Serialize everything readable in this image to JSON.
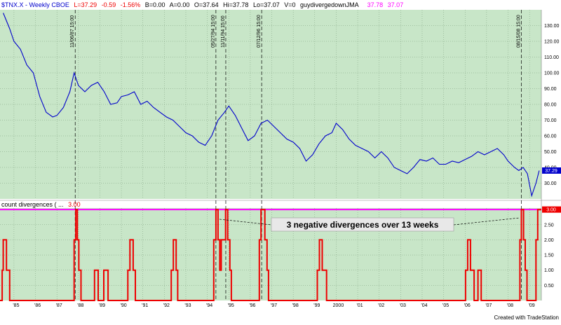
{
  "header": {
    "symbol": "$TNX.X - Weekly CBOE",
    "last": "L=37.29",
    "chg": "-0.59",
    "pct": "-1.56%",
    "bid": "B=0.00",
    "ask": "A=0.00",
    "open": "O=37.64",
    "high": "Hi=37.78",
    "low": "Lo=37.07",
    "vol": "V=0",
    "indicator_name": "guydivergedownJMA",
    "ind_v1": "37.78",
    "ind_v2": "37.07"
  },
  "lower_header": {
    "label": "count divergences ( ...",
    "value": "3.00"
  },
  "price_badge": "37.29",
  "count_badge": "3.00",
  "annotation": "3 negative divergences over 13 weeks",
  "footer": "Created with TradeStation",
  "colors": {
    "panel_bg": "#c8e6c8",
    "price_line": "#0000cc",
    "count_line": "#ee0000",
    "threshold_line": "#ff00ff",
    "badge_blue": "#0000cc",
    "badge_red": "#ee0000"
  },
  "chart_data": [
    {
      "type": "line",
      "title": "",
      "xlabel": "",
      "ylabel": "",
      "ylim": [
        20,
        140
      ],
      "yticks": [
        "130.00",
        "120.00",
        "110.00",
        "100.00",
        "90.00",
        "80.00",
        "70.00",
        "60.00",
        "50.00",
        "40.00",
        "30.00"
      ],
      "yticks_num": [
        130,
        120,
        110,
        100,
        90,
        80,
        70,
        60,
        50,
        40,
        30
      ],
      "xticks": [
        "'85",
        "'86",
        "'87",
        "'88",
        "'89",
        "'90",
        "'91",
        "'92",
        "'93",
        "'94",
        "'95",
        "'96",
        "'97",
        "'98",
        "'99",
        "2000",
        "'01",
        "'02",
        "'03",
        "'04",
        "'05",
        "'06",
        "'07",
        "'08",
        "'09"
      ],
      "xtick_year": [
        1985,
        1986,
        1987,
        1988,
        1989,
        1990,
        1991,
        1992,
        1993,
        1994,
        1995,
        1996,
        1997,
        1998,
        1999,
        2000,
        2001,
        2002,
        2003,
        2004,
        2005,
        2006,
        2007,
        2008,
        2009
      ],
      "grid": true,
      "series": [
        {
          "x": [
            1984.5,
            1984.8,
            1985.0,
            1985.3,
            1985.6,
            1985.9,
            1986.2,
            1986.5,
            1986.8,
            1987.0,
            1987.3,
            1987.6,
            1987.8,
            1988.0,
            1988.3,
            1988.6,
            1988.9,
            1989.2,
            1989.5,
            1989.8,
            1990.0,
            1990.3,
            1990.6,
            1990.9,
            1991.2,
            1991.5,
            1991.8,
            1992.1,
            1992.4,
            1992.7,
            1993.0,
            1993.3,
            1993.6,
            1993.9,
            1994.2,
            1994.5,
            1994.8,
            1995.0,
            1995.3,
            1995.6,
            1995.9,
            1996.2,
            1996.5,
            1996.8,
            1997.1,
            1997.4,
            1997.7,
            1998.0,
            1998.3,
            1998.6,
            1998.9,
            1999.2,
            1999.5,
            1999.8,
            2000.0,
            2000.3,
            2000.6,
            2000.9,
            2001.2,
            2001.5,
            2001.8,
            2002.1,
            2002.4,
            2002.7,
            2003.0,
            2003.3,
            2003.6,
            2003.9,
            2004.2,
            2004.5,
            2004.8,
            2005.1,
            2005.4,
            2005.7,
            2006.0,
            2006.3,
            2006.6,
            2006.9,
            2007.2,
            2007.5,
            2007.8,
            2008.0,
            2008.3,
            2008.5,
            2008.7,
            2008.9,
            2009.1,
            2009.3,
            2009.45
          ],
          "y": [
            138,
            128,
            120,
            115,
            105,
            100,
            85,
            75,
            72,
            73,
            78,
            88,
            100,
            92,
            88,
            92,
            94,
            88,
            80,
            81,
            85,
            86,
            88,
            80,
            82,
            78,
            75,
            72,
            70,
            66,
            62,
            60,
            56,
            54,
            60,
            70,
            75,
            79,
            73,
            65,
            57,
            60,
            68,
            70,
            66,
            62,
            58,
            56,
            52,
            44,
            48,
            55,
            60,
            62,
            68,
            64,
            58,
            54,
            52,
            50,
            46,
            50,
            46,
            40,
            38,
            36,
            40,
            45,
            44,
            46,
            42,
            42,
            44,
            43,
            45,
            47,
            50,
            48,
            50,
            52,
            48,
            44,
            40,
            38,
            40,
            36,
            22,
            30,
            38
          ]
        }
      ]
    },
    {
      "type": "line",
      "title": "",
      "xlabel": "",
      "ylabel": "",
      "ylim": [
        0,
        3.05
      ],
      "yticks": [
        "3.00",
        "2.50",
        "2.00",
        "1.50",
        "1.00",
        "0.50"
      ],
      "yticks_num": [
        3.0,
        2.5,
        2.0,
        1.5,
        1.0,
        0.5
      ],
      "threshold": 3.0,
      "series": [
        {
          "name": "count divergences",
          "points": [
            [
              1984.3,
              0
            ],
            [
              1984.45,
              1
            ],
            [
              1984.5,
              2
            ],
            [
              1984.65,
              1
            ],
            [
              1984.8,
              0
            ],
            [
              1987.78,
              0
            ],
            [
              1987.8,
              2
            ],
            [
              1987.88,
              3
            ],
            [
              1987.95,
              2
            ],
            [
              1988.02,
              1
            ],
            [
              1988.12,
              0
            ],
            [
              1988.72,
              0
            ],
            [
              1988.75,
              1
            ],
            [
              1988.88,
              1
            ],
            [
              1988.92,
              0
            ],
            [
              1989.15,
              0
            ],
            [
              1989.18,
              1
            ],
            [
              1989.35,
              1
            ],
            [
              1989.38,
              0
            ],
            [
              1990.28,
              0
            ],
            [
              1990.3,
              1
            ],
            [
              1990.4,
              2
            ],
            [
              1990.55,
              1
            ],
            [
              1990.65,
              0
            ],
            [
              1992.3,
              0
            ],
            [
              1992.32,
              1
            ],
            [
              1992.42,
              2
            ],
            [
              1992.55,
              1
            ],
            [
              1992.62,
              0
            ],
            [
              1994.28,
              0
            ],
            [
              1994.3,
              2
            ],
            [
              1994.4,
              3
            ],
            [
              1994.5,
              2
            ],
            [
              1994.58,
              1
            ],
            [
              1994.65,
              2
            ],
            [
              1994.78,
              2
            ],
            [
              1994.85,
              3
            ],
            [
              1994.95,
              2
            ],
            [
              1995.05,
              1
            ],
            [
              1995.12,
              0
            ],
            [
              1996.4,
              0
            ],
            [
              1996.42,
              2
            ],
            [
              1996.5,
              3
            ],
            [
              1996.6,
              3
            ],
            [
              1996.68,
              2
            ],
            [
              1996.78,
              1
            ],
            [
              1996.85,
              0
            ],
            [
              1999.1,
              0
            ],
            [
              1999.12,
              1
            ],
            [
              1999.22,
              2
            ],
            [
              1999.35,
              1
            ],
            [
              1999.48,
              1
            ],
            [
              1999.55,
              0
            ],
            [
              2006.0,
              0
            ],
            [
              2006.02,
              1
            ],
            [
              2006.12,
              2
            ],
            [
              2006.25,
              1
            ],
            [
              2006.35,
              1
            ],
            [
              2006.42,
              0
            ],
            [
              2006.58,
              0
            ],
            [
              2006.6,
              1
            ],
            [
              2006.72,
              1
            ],
            [
              2006.75,
              0
            ],
            [
              2008.52,
              0
            ],
            [
              2008.55,
              2
            ],
            [
              2008.62,
              3
            ],
            [
              2008.72,
              2
            ],
            [
              2008.8,
              1
            ],
            [
              2008.88,
              0
            ],
            [
              2009.28,
              0
            ],
            [
              2009.3,
              2
            ],
            [
              2009.38,
              3
            ]
          ]
        }
      ]
    }
  ],
  "event_markers": [
    {
      "label": "11/06/87 15:00",
      "x": 1987.85
    },
    {
      "label": "05/27/94 15:00",
      "x": 1994.4
    },
    {
      "label": "11/11/94 15:00",
      "x": 1994.86
    },
    {
      "label": "07/12/96 15:00",
      "x": 1996.53
    },
    {
      "label": "08/15/08 15:00",
      "x": 2008.62
    }
  ]
}
